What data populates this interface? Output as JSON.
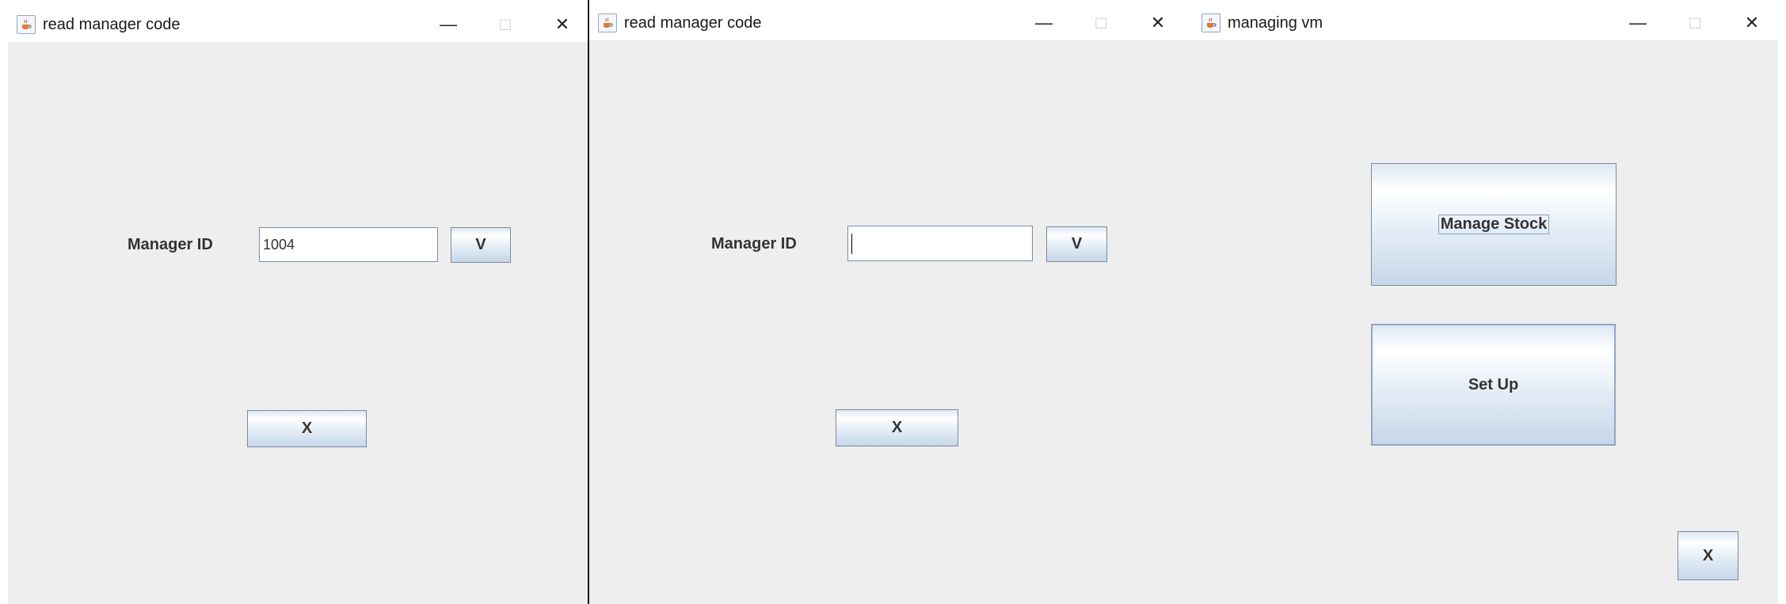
{
  "windows": [
    {
      "title": "read manager code",
      "icon": "java-cup-icon",
      "controls": {
        "minimize": "—",
        "maximize": "□",
        "close": "✕"
      },
      "manager_id_label": "Manager ID",
      "manager_id_value": "1004",
      "verify_label": "V",
      "close_label": "X"
    },
    {
      "title": "read manager code",
      "icon": "java-cup-icon",
      "controls": {
        "minimize": "—",
        "maximize": "□",
        "close": "✕"
      },
      "manager_id_label": "Manager ID",
      "manager_id_value": "",
      "verify_label": "V",
      "close_label": "X"
    },
    {
      "title": "managing vm",
      "icon": "java-cup-icon",
      "controls": {
        "minimize": "—",
        "maximize": "□",
        "close": "✕"
      },
      "manage_stock_label": "Manage Stock",
      "setup_label": "Set Up",
      "close_label": "X"
    }
  ],
  "colors": {
    "window_bg": "#eeeeee",
    "titlebar_bg": "#ffffff",
    "button_border": "#7a8aa0",
    "field_border": "#7a8ea6"
  }
}
